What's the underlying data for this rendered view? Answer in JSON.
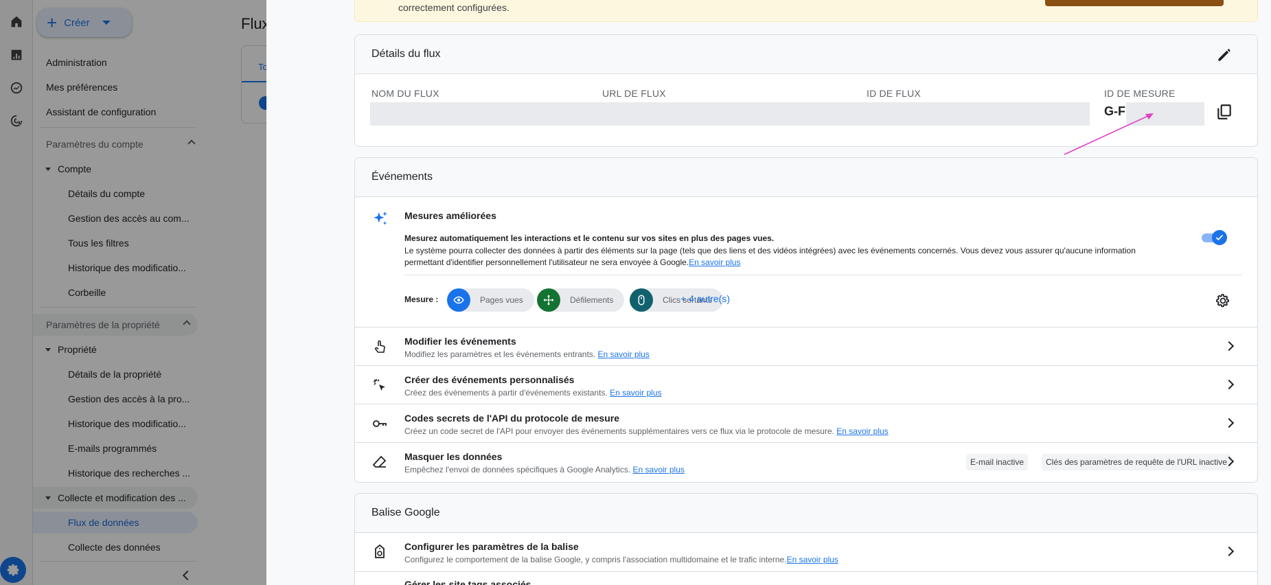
{
  "background": {
    "create_label": "Créer",
    "page_title_partial": "Flux",
    "tab_partial": "To",
    "nav": {
      "administration": "Administration",
      "preferences": "Mes préférences",
      "setup_assistant": "Assistant de configuration",
      "account_section": "Paramètres du compte",
      "account": "Compte",
      "account_items": [
        "Détails du compte",
        "Gestion des accès au com...",
        "Tous les filtres",
        "Historique des modificatio...",
        "Corbeille"
      ],
      "property_section": "Paramètres de la propriété",
      "property": "Propriété",
      "property_items": [
        "Détails de la propriété",
        "Gestion des accès à la pro...",
        "Historique des modificatio...",
        "E-mails programmés",
        "Historique des recherches ..."
      ],
      "collection_group": "Collecte et modification des ...",
      "collection_items": [
        "Flux de données",
        "Collecte des données"
      ]
    }
  },
  "banner": {
    "text": "correctement configurées."
  },
  "details": {
    "title": "Détails du flux",
    "labels": {
      "name": "NOM DU FLUX",
      "url": "URL DE FLUX",
      "id": "ID DE FLUX",
      "measurement_id": "ID DE MESURE"
    },
    "measurement_id_visible": "G-F"
  },
  "events": {
    "title": "Événements",
    "enhanced": {
      "title": "Mesures améliorées",
      "desc_bold": "Mesurez automatiquement les interactions et le contenu sur vos sites en plus des pages vues.",
      "desc": "Le système pourra collecter des données à partir des éléments sur la page (tels que des liens et des vidéos intégrées) avec les événements concernés. Vous devez vous assurer qu'aucune information permettant d'identifier personnellement l'utilisateur ne sera envoyée à Google.",
      "link": "En savoir plus",
      "enabled": true,
      "measure_label": "Mesure :",
      "chips": [
        "Pages vues",
        "Défilements",
        "Clics sortants"
      ],
      "more": "+ 4 autre(s)"
    },
    "rows": [
      {
        "title": "Modifier les événements",
        "desc": "Modifiez les paramètres et les événements entrants.",
        "link": "En savoir plus"
      },
      {
        "title": "Créer des événements personnalisés",
        "desc": "Créez des événements à partir d'événements existants.",
        "link": "En savoir plus"
      },
      {
        "title": "Codes secrets de l'API du protocole de mesure",
        "desc": "Créez un code secret de l'API pour envoyer des événements supplémentaires vers ce flux via le protocole de mesure.",
        "link": "En savoir plus"
      },
      {
        "title": "Masquer les données",
        "desc": "Empêchez l'envoi de données spécifiques à Google Analytics.",
        "link": "En savoir plus",
        "badges": [
          "E-mail inactive",
          "Clés des paramètres de requête de l'URL inactive"
        ]
      }
    ]
  },
  "google_tag": {
    "title": "Balise Google",
    "rows": [
      {
        "title": "Configurer les paramètres de la balise",
        "desc": "Configurez le comportement de la balise Google, y compris l'association multidomaine et le trafic interne.",
        "link": "En savoir plus"
      },
      {
        "title": "Gérer les site tags associés"
      }
    ]
  },
  "colors": {
    "accent": "#1a73e8",
    "annotation_arrow": "#e040c8",
    "chip_pageviews": "#1a73e8",
    "chip_scrolls": "#137333",
    "chip_outbound": "#12616f"
  }
}
